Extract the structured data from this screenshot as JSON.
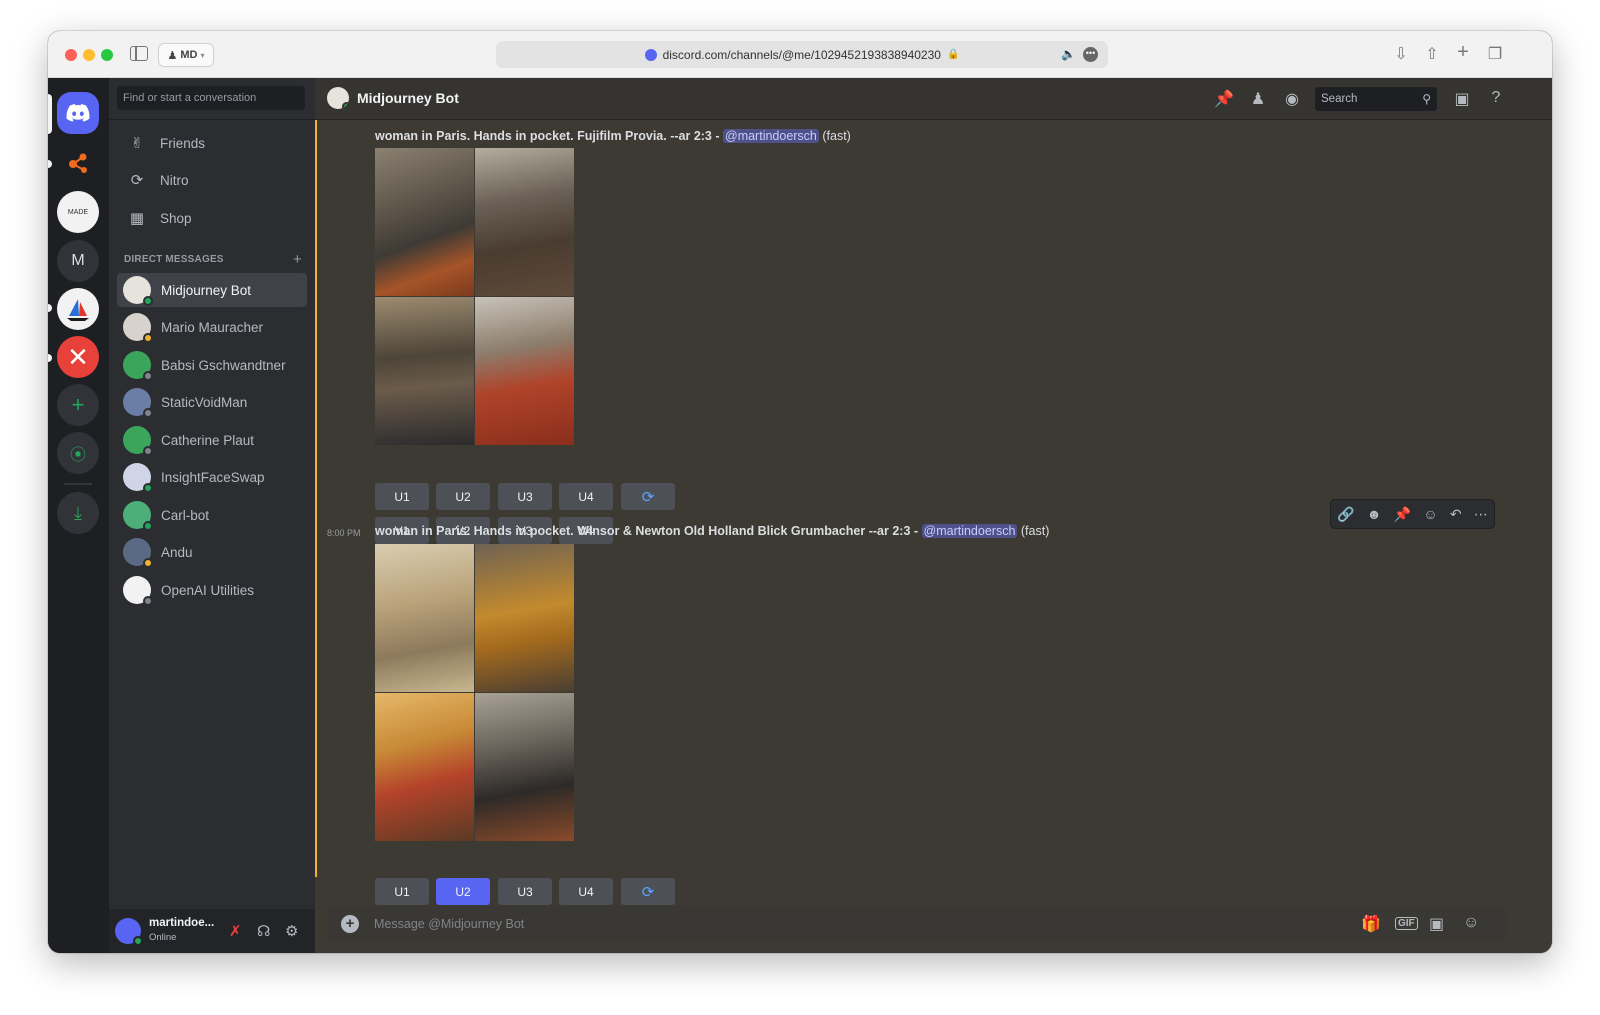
{
  "browser": {
    "profile": "MD",
    "url": "discord.com/channels/@me/1029452193838940230"
  },
  "sidebar": {
    "find_placeholder": "Find or start a conversation",
    "nav": [
      {
        "label": "Friends",
        "icon": "friends-icon"
      },
      {
        "label": "Nitro",
        "icon": "nitro-icon"
      },
      {
        "label": "Shop",
        "icon": "shop-icon"
      }
    ],
    "dm_header": "DIRECT MESSAGES",
    "dms": [
      {
        "name": "Midjourney Bot",
        "status": "online",
        "color": "#e6e3dc"
      },
      {
        "name": "Mario Mauracher",
        "status": "idle",
        "color": "#d8d2cc"
      },
      {
        "name": "Babsi Gschwandtner",
        "status": "offline",
        "color": "#3ba55c"
      },
      {
        "name": "StaticVoidMan",
        "status": "offline",
        "color": "#6b7fa6"
      },
      {
        "name": "Catherine Plaut",
        "status": "offline",
        "color": "#3ba55c"
      },
      {
        "name": "InsightFaceSwap",
        "status": "online",
        "color": "#cfd5e6"
      },
      {
        "name": "Carl-bot",
        "status": "online",
        "color": "#4caf7a"
      },
      {
        "name": "Andu",
        "status": "idle",
        "color": "#5a6a85"
      },
      {
        "name": "OpenAI Utilities",
        "status": "offline",
        "color": "#f2f2f2"
      }
    ]
  },
  "user": {
    "name": "martindoe...",
    "status": "Online"
  },
  "channel": {
    "name": "Midjourney Bot",
    "search_placeholder": "Search"
  },
  "messages": [
    {
      "timestamp": "",
      "prompt": "woman in Paris. Hands in pocket. Fujifilm Provia. --ar 2:3 - ",
      "mention": "@martindoersch",
      "speed": "(fast)",
      "upscale": [
        "U1",
        "U2",
        "U3",
        "U4"
      ],
      "variation": [
        "V1",
        "V2",
        "V3",
        "V4"
      ],
      "selected": ""
    },
    {
      "timestamp": "8:00 PM",
      "prompt": "woman in Paris. Hands in pocket. Winsor & Newton Old Holland Blick Grumbacher --ar 2:3 - ",
      "mention": "@martindoersch",
      "speed": "(fast)",
      "upscale": [
        "U1",
        "U2",
        "U3",
        "U4"
      ],
      "selected": "U2"
    }
  ],
  "composer": {
    "placeholder": "Message @Midjourney Bot"
  },
  "colors": {
    "accent": "#5865f2",
    "online": "#23a55a",
    "idle": "#f0b232",
    "mention_bg": "#4e518a"
  }
}
